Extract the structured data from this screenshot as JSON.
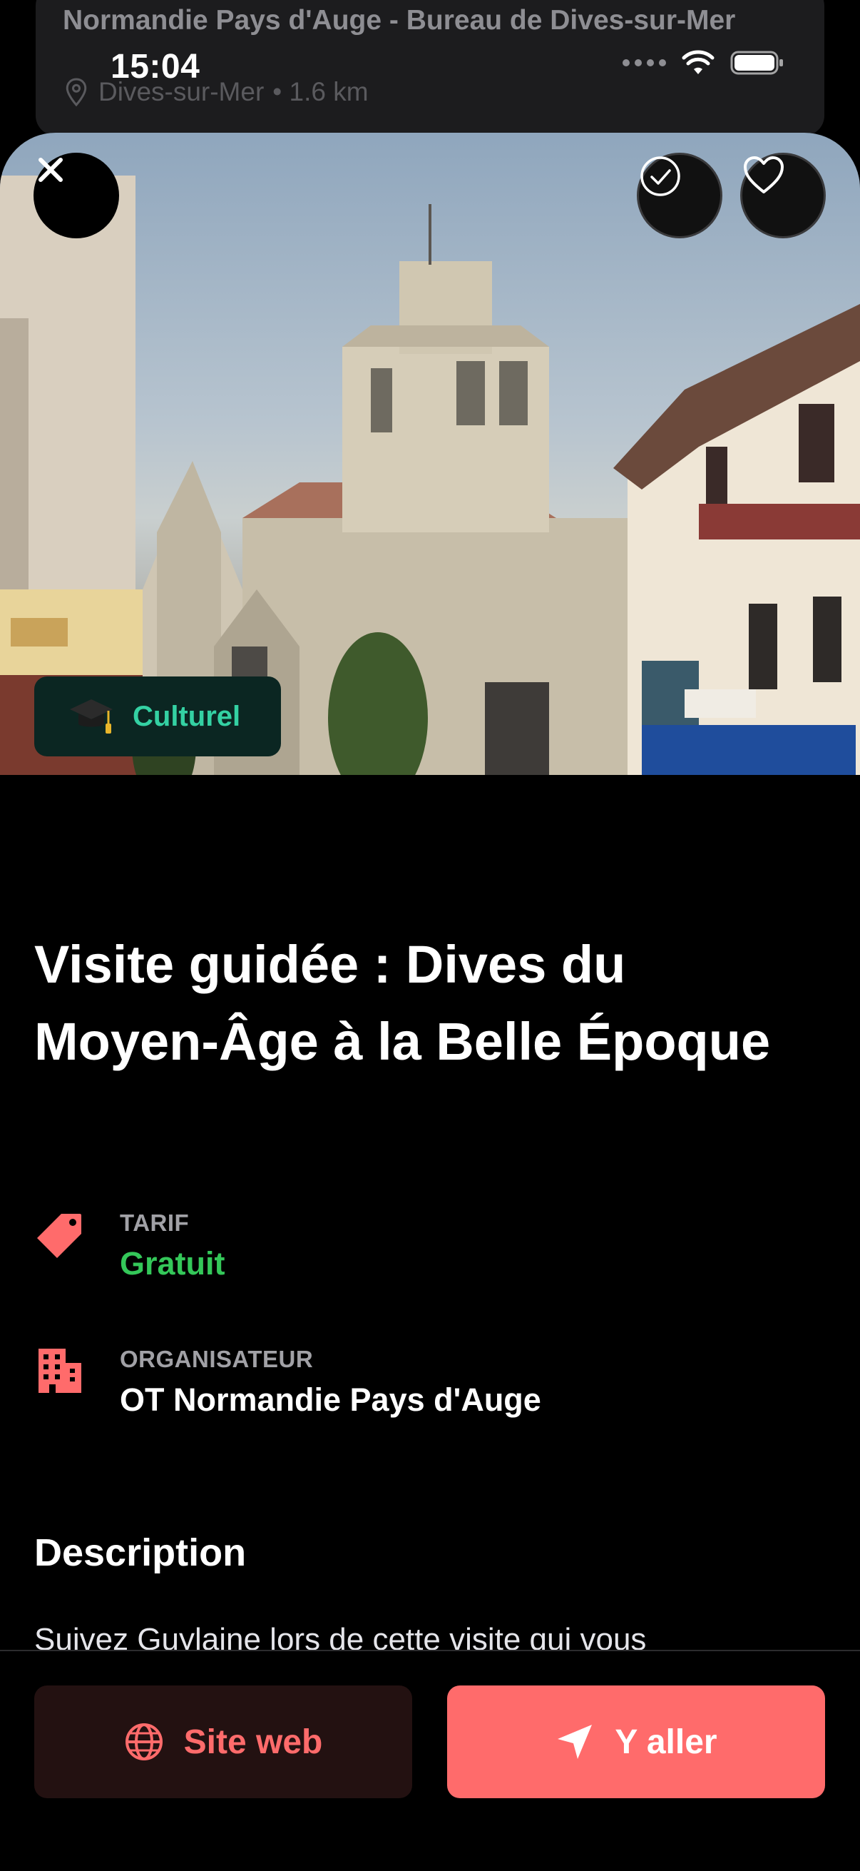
{
  "background_card": {
    "title": "Normandie Pays d'Auge - Bureau de Dives-sur-Mer",
    "city": "Dives-sur-Mer",
    "distance": "• 1.6 km"
  },
  "status_bar": {
    "time": "15:04"
  },
  "hero": {
    "alt_icons": [
      "close-icon",
      "check-circle-icon",
      "heart-icon"
    ]
  },
  "category": {
    "label": "Culturel",
    "icon": "graduation-cap-icon"
  },
  "event": {
    "title": "Visite guidée : Dives du Moyen-Âge à la Belle Époque"
  },
  "details": {
    "price_label": "TARIF",
    "price_value": "Gratuit",
    "organizer_label": "ORGANISATEUR",
    "organizer_value": "OT Normandie Pays d'Auge"
  },
  "description": {
    "heading": "Description",
    "text": "Suivez Guylaine lors de cette visite qui vous"
  },
  "actions": {
    "website_label": "Site web",
    "directions_label": "Y aller"
  },
  "colors": {
    "accent": "#ff6b6b",
    "category_accent": "#34d1a3",
    "price_green": "#34c759"
  }
}
